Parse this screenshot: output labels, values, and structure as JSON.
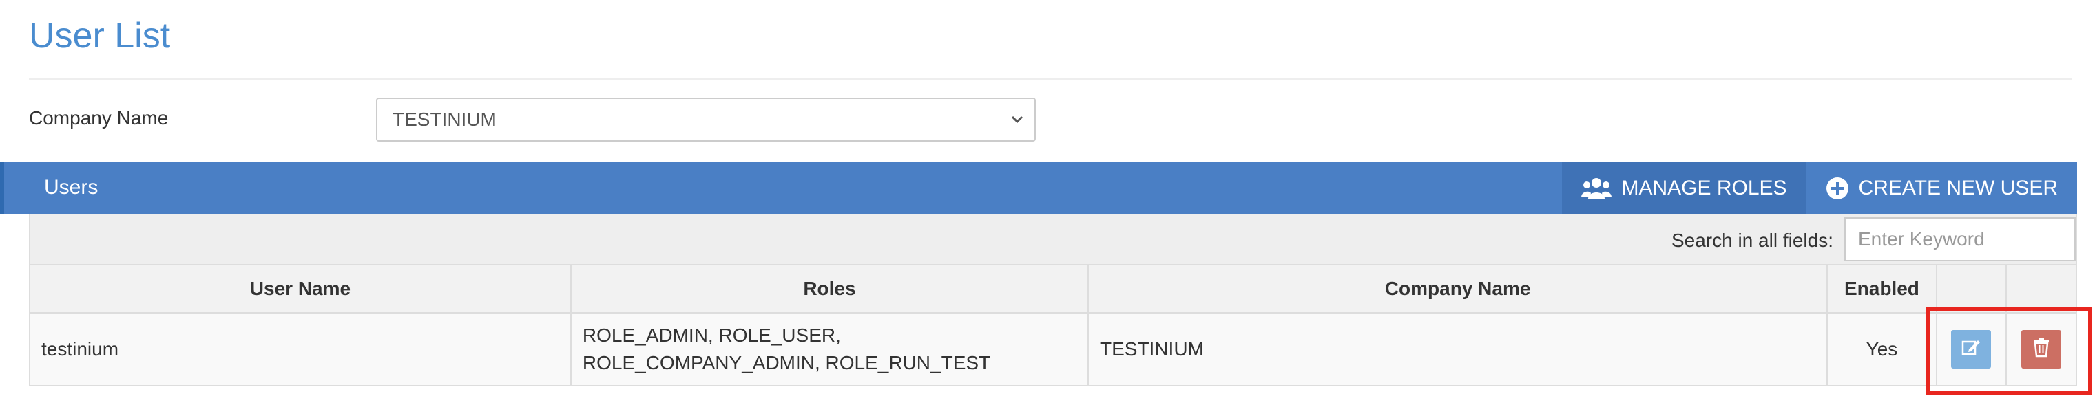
{
  "page": {
    "title": "User List"
  },
  "filter": {
    "company_label": "Company Name",
    "company_value": "TESTINIUM"
  },
  "panel": {
    "title": "Users",
    "manage_roles_label": "MANAGE ROLES",
    "create_user_label": "CREATE NEW USER",
    "search_label": "Search in all fields:",
    "search_placeholder": "Enter Keyword"
  },
  "table": {
    "headers": [
      "User Name",
      "Roles",
      "Company Name",
      "Enabled",
      "",
      ""
    ],
    "rows": [
      {
        "user_name": "testinium",
        "roles": "ROLE_ADMIN, ROLE_USER, ROLE_COMPANY_ADMIN, ROLE_RUN_TEST",
        "company": "TESTINIUM",
        "enabled": "Yes"
      }
    ]
  },
  "icons": {
    "manage_roles": "users-group-icon",
    "create_user": "plus-circle-icon",
    "edit": "edit-icon",
    "delete": "trash-icon",
    "select": "chevron-down-icon"
  },
  "colors": {
    "title": "#4a8ccf",
    "bar": "#4a7fc5",
    "edit_button": "#7fb2df",
    "delete_button": "#cc6f63",
    "highlight": "#e8261f"
  }
}
